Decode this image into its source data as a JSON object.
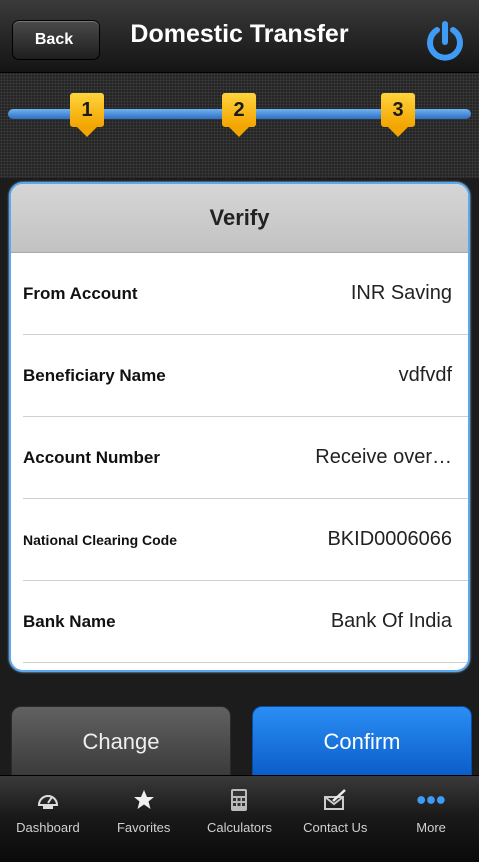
{
  "nav": {
    "back_label": "Back",
    "title": "Domestic Transfer",
    "power_icon": "power-icon"
  },
  "steps": [
    "1",
    "2",
    "3"
  ],
  "card": {
    "title": "Verify",
    "rows": [
      {
        "label": "From Account",
        "value": "INR Saving"
      },
      {
        "label": "Beneficiary Name",
        "value": "vdfvdf"
      },
      {
        "label": "Account Number",
        "value": "Receive over…"
      },
      {
        "label": "National Clearing Code",
        "value": "BKID0006066"
      },
      {
        "label": "Bank Name",
        "value": "Bank Of India"
      }
    ]
  },
  "buttons": {
    "change_label": "Change",
    "confirm_label": "Confirm"
  },
  "tabs": [
    {
      "label": "Dashboard",
      "icon": "dashboard-icon"
    },
    {
      "label": "Favorites",
      "icon": "star-icon"
    },
    {
      "label": "Calculators",
      "icon": "calculator-icon"
    },
    {
      "label": "Contact Us",
      "icon": "contact-icon"
    },
    {
      "label": "More",
      "icon": "more-icon"
    }
  ],
  "colors": {
    "accent": "#0a5cc9",
    "step": "#f2a400",
    "card_border": "#5aa9f0"
  }
}
